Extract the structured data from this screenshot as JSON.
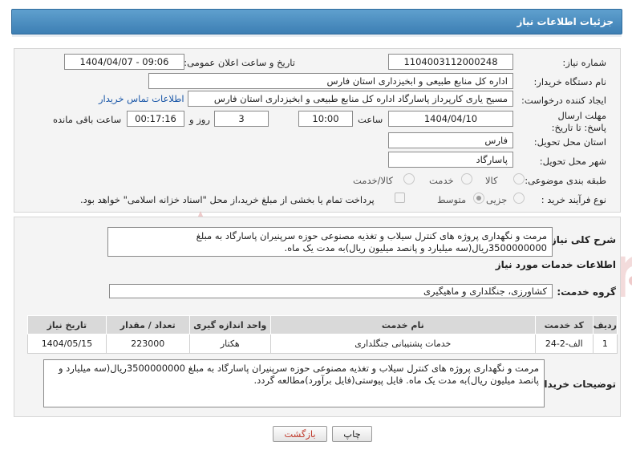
{
  "header": {
    "title": "جزئیات اطلاعات نیاز"
  },
  "fields": {
    "need_number_label": "شماره نیاز:",
    "need_number": "1104003112000248",
    "announce_label": "تاریخ و ساعت اعلان عمومی:",
    "announce_value": "1404/04/07 - 09:06",
    "buyer_label": "نام دستگاه خریدار:",
    "buyer_value": "اداره کل منابع طبیعی و ابخیزداری استان فارس",
    "creator_label": "ایجاد کننده درخواست:",
    "creator_value": "مسیح یاری کارپرداز پاسارگاد اداره کل منابع طبیعی و ابخیزداری استان فارس",
    "contact_link": "اطلاعات تماس خریدار",
    "deadline_label": "مهلت ارسال پاسخ: تا تاریخ:",
    "deadline_date": "1404/04/10",
    "time_label": "ساعت",
    "deadline_time": "10:00",
    "days_value": "3",
    "days_label": "روز و",
    "remaining_time": "00:17:16",
    "remaining_label": "ساعت باقی مانده",
    "province_label": "استان محل تحویل:",
    "province_value": "فارس",
    "city_label": "شهر محل تحویل:",
    "city_value": "پاسارگاد",
    "category_label": "طبقه بندی موضوعی:",
    "category_options": [
      "کالا",
      "خدمت",
      "کالا/خدمت"
    ],
    "process_label": "نوع فرآیند خرید :",
    "process_options": [
      "جزیی",
      "متوسط"
    ],
    "payment_note": "پرداخت تمام یا بخشی از مبلغ خرید،از محل \"اسناد خزانه اسلامی\" خواهد بود."
  },
  "description": {
    "label": "شرح کلی نیاز:",
    "text": "مرمت و نگهداری پروژه های کنترل سیلاب و تغذیه مصنوعی حوزه سرپنیران پاسارگاد به مبلغ 3500000000ریال(سه میلیارد و پانصد میلیون ریال)به مدت یک ماه."
  },
  "services": {
    "section_title": "اطلاعات خدمات مورد نیاز",
    "group_label": "گروه خدمت:",
    "group_value": "کشاورزی، جنگلداری و ماهیگیری",
    "columns": [
      "ردیف",
      "کد خدمت",
      "نام خدمت",
      "واحد اندازه گیری",
      "تعداد / مقدار",
      "تاریخ نیاز"
    ],
    "rows": [
      [
        "1",
        "الف-2-24",
        "خدمات پشتیبانی جنگلداری",
        "هکتار",
        "223000",
        "1404/05/15"
      ]
    ]
  },
  "buyer_notes": {
    "label": "توضیحات خریدار:",
    "text": "مرمت و نگهداری پروژه های کنترل سیلاب و تغذیه مصنوعی حوزه سرپنیران پاسارگاد به مبلغ 3500000000ریال(سه میلیارد و پانصد میلیون ریال)به مدت یک ماه. فایل پیوستی(فایل برآورد)مطالعه گردد."
  },
  "buttons": {
    "print": "چاپ",
    "back": "بازگشت"
  },
  "colors": {
    "header": "#4a8cc0",
    "watermark": "#e8b4b4"
  }
}
